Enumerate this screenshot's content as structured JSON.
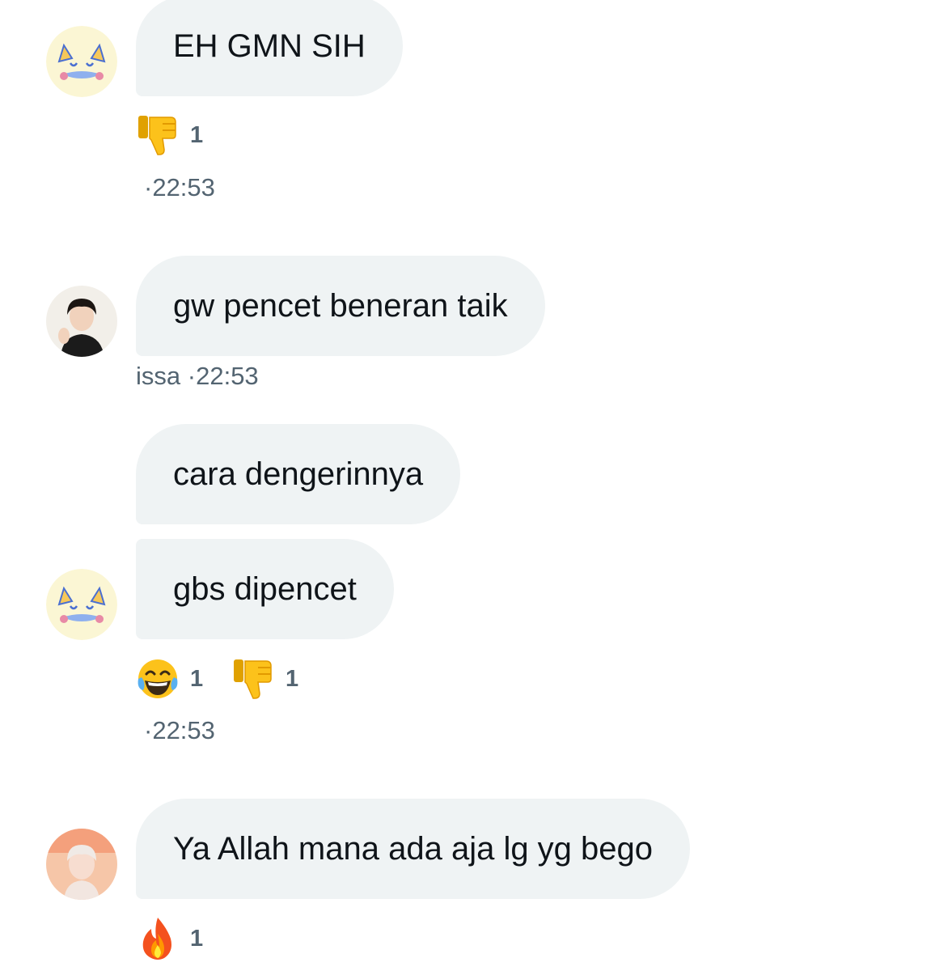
{
  "messages": [
    {
      "text": "EH GMN SIH",
      "time": "22:53",
      "sender": "",
      "reactions": [
        {
          "emoji": "thumbs-down",
          "count": "1"
        }
      ]
    },
    {
      "text": "gw pencet beneran taik",
      "time": "22:53",
      "sender": "issa",
      "reactions": []
    },
    {
      "text": "cara dengerinnya",
      "reactions": []
    },
    {
      "text": "gbs dipencet",
      "time": "22:53",
      "sender": "",
      "reactions": [
        {
          "emoji": "tears-of-joy",
          "count": "1"
        },
        {
          "emoji": "thumbs-down",
          "count": "1"
        }
      ]
    },
    {
      "text": "Ya Allah mana ada aja lg yg bego",
      "reactions": [
        {
          "emoji": "fire",
          "count": "1"
        }
      ]
    }
  ],
  "meta_separator": "·",
  "colors": {
    "bubble": "#eff3f4",
    "meta_text": "#536471",
    "message_text": "#0f1419"
  }
}
